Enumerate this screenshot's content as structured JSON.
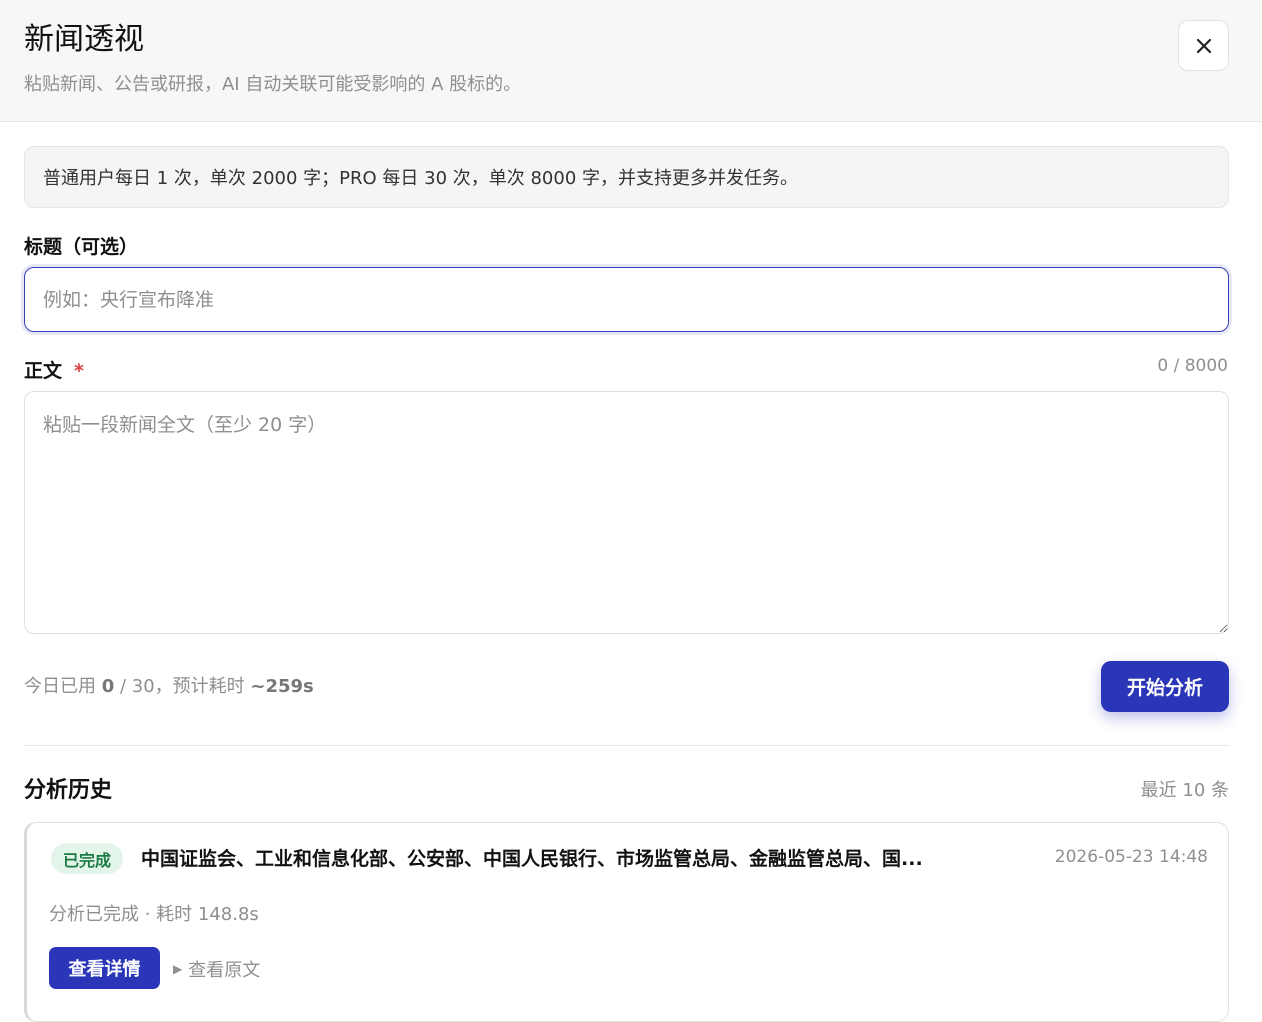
{
  "header": {
    "title": "新闻透视",
    "subtitle": "粘贴新闻、公告或研报，AI 自动关联可能受影响的 A 股标的。"
  },
  "notice": "普通用户每日 1 次，单次 2000 字；PRO 每日 30 次，单次 8000 字，并支持更多并发任务。",
  "form": {
    "title_label": "标题（可选）",
    "title_placeholder": "例如：央行宣布降准",
    "title_value": "",
    "body_label": "正文",
    "required_mark": "*",
    "char_count": "0 / 8000",
    "body_placeholder": "粘贴一段新闻全文（至少 20 字）",
    "body_value": ""
  },
  "usage": {
    "prefix": "今日已用 ",
    "used": "0",
    "mid": " / 30，预计耗时 ",
    "estimate": "~259s"
  },
  "start_button_label": "开始分析",
  "history": {
    "title": "分析历史",
    "count_label": "最近 10 条",
    "items": [
      {
        "status": "已完成",
        "title": "中国证监会、工业和信息化部、公安部、中国人民银行、市场监管总局、金融监管总局、国...",
        "timestamp": "2026-05-23 14:48",
        "meta": "分析已完成 · 耗时 148.8s",
        "detail_label": "查看详情",
        "original_label": "查看原文"
      }
    ]
  },
  "colors": {
    "accent": "#2a35b8",
    "success_bg": "#e3f5ea",
    "success_text": "#1d7a43",
    "required": "#d94040"
  },
  "icons": {
    "close": "close-icon",
    "caret": "caret-right-icon"
  }
}
